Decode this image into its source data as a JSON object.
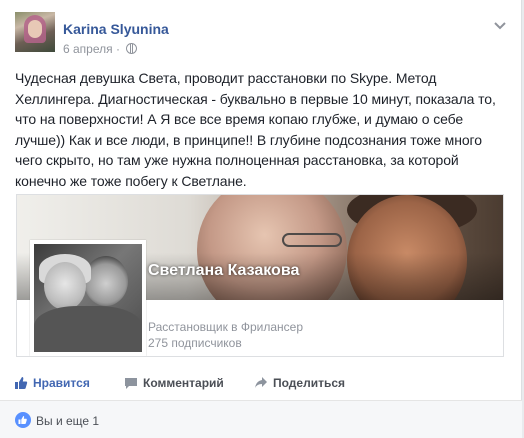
{
  "post": {
    "author": "Karina Slyunina",
    "date": "6 апреля",
    "separator": "·",
    "privacy_icon": "globe-icon",
    "menu_icon": "chevron-down-icon",
    "text": "Чудесная девушка Света, проводит расстановки по Skype. Метод Хеллингера. Диагностическая - буквально в первые 10 минут, показала то, что на поверхности! А Я все все время копаю глубже, и думаю о себе лучше)) Как и все люди, в принципе!! В глубине подсознания тоже много чего скрыто, но там уже нужна полноценная расстановка, за которой конечно же тоже побегу к Светлане."
  },
  "link_card": {
    "page_name": "Светлана Казакова",
    "category": "Расстановщик в Фрилансер",
    "subscribers": "275 подписчиков"
  },
  "actions": {
    "like": "Нравится",
    "comment": "Комментарий",
    "share": "Поделиться"
  },
  "footer": {
    "reactions": "Вы и еще 1",
    "reaction_icon": "like-icon"
  },
  "colors": {
    "accent": "#4267b2",
    "author": "#365899",
    "muted": "#90949c"
  }
}
